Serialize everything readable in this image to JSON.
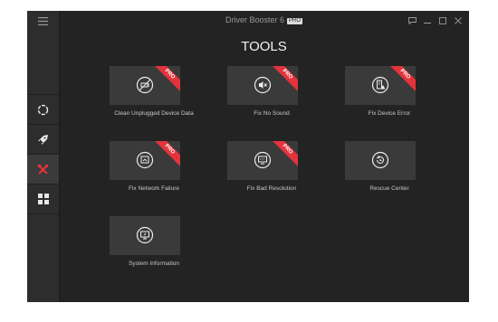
{
  "app": {
    "title": "Driver Booster 6",
    "badge": "PRO"
  },
  "heading": "TOOLS",
  "sidebar": {
    "items": [
      {
        "icon": "scan-icon"
      },
      {
        "icon": "rocket-icon"
      },
      {
        "icon": "tools-icon",
        "active": true
      },
      {
        "icon": "grid-icon"
      }
    ]
  },
  "tools": [
    {
      "label": "Clean Unplugged Device Data",
      "pro": "PRO",
      "icon": "unplug-icon"
    },
    {
      "label": "Fix No Sound",
      "pro": "PRO",
      "icon": "mute-icon"
    },
    {
      "label": "Fix Device Error",
      "pro": "PRO",
      "icon": "device-error-icon"
    },
    {
      "label": "Fix Network Failure",
      "pro": "PRO",
      "icon": "network-icon"
    },
    {
      "label": "Fix Bad Resolution",
      "pro": "PRO",
      "icon": "resolution-icon"
    },
    {
      "label": "Rescue Center",
      "icon": "restore-icon"
    },
    {
      "label": "System Information",
      "icon": "monitor-info-icon"
    }
  ],
  "colors": {
    "accent": "#e3333b",
    "background": "#232323",
    "tile": "#3a3a3a",
    "sidebar": "#2d2d2d"
  }
}
